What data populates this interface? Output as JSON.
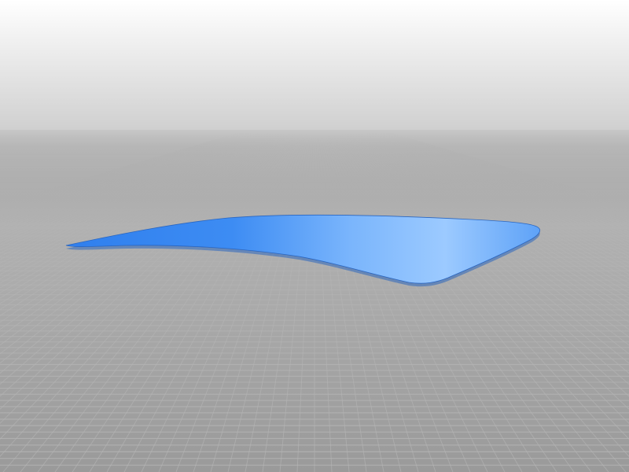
{
  "scene": {
    "background_top": "#ffffff",
    "background_horizon": "#c8c8c8",
    "floor_color": "#9a9a9a",
    "grid_color": "#b4b4b4",
    "model_color_dark": "#2f7fee",
    "model_color_mid": "#5ea2f7",
    "model_color_light": "#9ccaff",
    "model_edge_color": "#2a66c0"
  }
}
